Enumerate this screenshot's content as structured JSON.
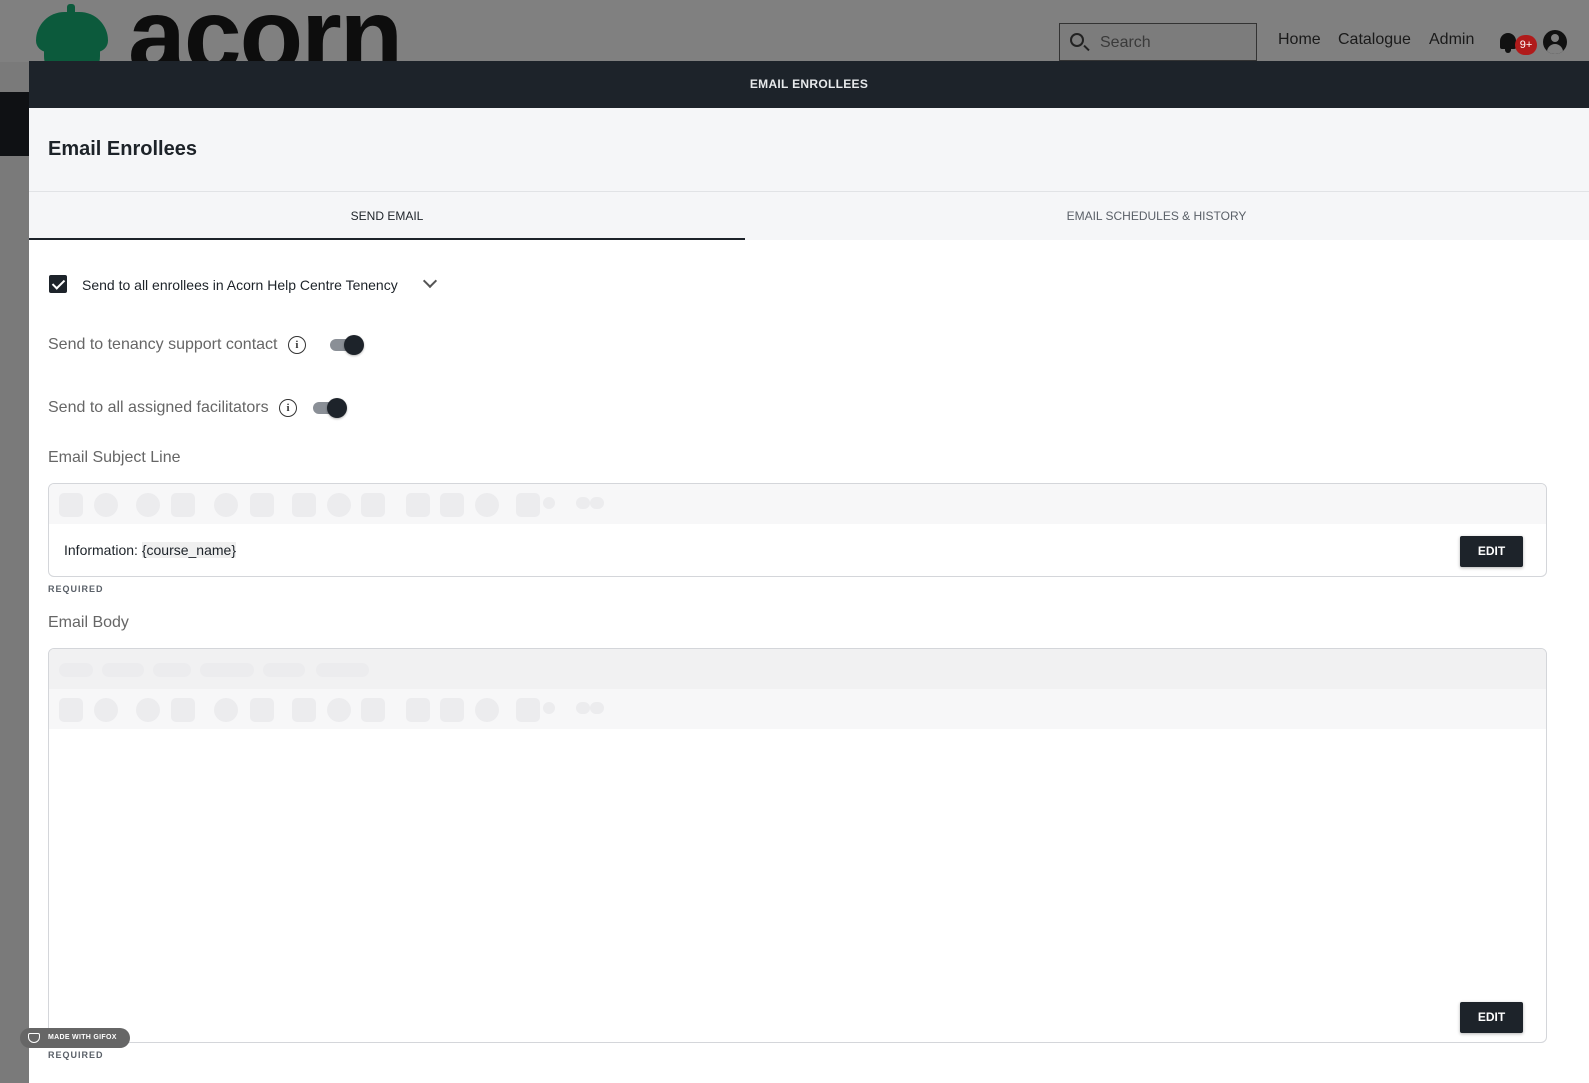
{
  "app": {
    "logo_text": "acorn",
    "search": {
      "placeholder": "Search"
    },
    "nav": {
      "home": "Home",
      "catalogue": "Catalogue",
      "admin": "Admin"
    },
    "notifications_badge": "9+"
  },
  "modal": {
    "bar_title": "EMAIL ENROLLEES",
    "title": "Email Enrollees",
    "tabs": [
      {
        "label": "SEND EMAIL",
        "active": true
      },
      {
        "label": "EMAIL SCHEDULES & HISTORY",
        "active": false
      }
    ],
    "send_to_all": {
      "label": "Send to all enrollees in Acorn Help Centre Tenency",
      "checked": true
    },
    "toggles": [
      {
        "label": "Send to tenancy support contact",
        "on": true
      },
      {
        "label": "Send to all assigned facilitators",
        "on": true
      }
    ],
    "subject": {
      "label": "Email Subject Line",
      "value_prefix": "Information: ",
      "value_token": "{course_name}",
      "edit_label": "EDIT",
      "required": "REQUIRED"
    },
    "body": {
      "label": "Email Body",
      "edit_label": "EDIT",
      "required": "REQUIRED"
    },
    "watermark": "MADE WITH GIFOX"
  },
  "colors": {
    "accent": "#1d232a",
    "brand_green": "#0c5a3c",
    "badge": "#b01b1b"
  }
}
